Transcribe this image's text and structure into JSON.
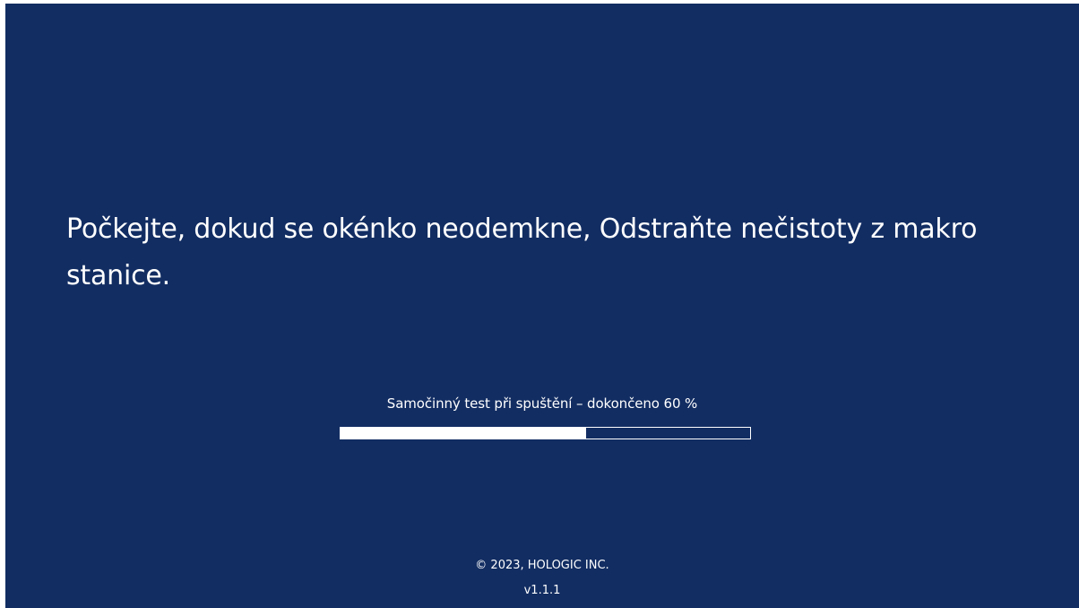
{
  "message": "Počkejte, dokud se okénko neodemkne, Odstraňte nečistoty z makro stanice.",
  "progress": {
    "label": "Samočinný test při spuštění – dokončeno 60 %",
    "fraction": 0.6
  },
  "footer": {
    "copyright": "© 2023, HOLOGIC INC.",
    "version": "v1.1.1"
  },
  "colors": {
    "background": "#122d62",
    "text": "#ffffff",
    "progress_fill": "#ffffff"
  }
}
